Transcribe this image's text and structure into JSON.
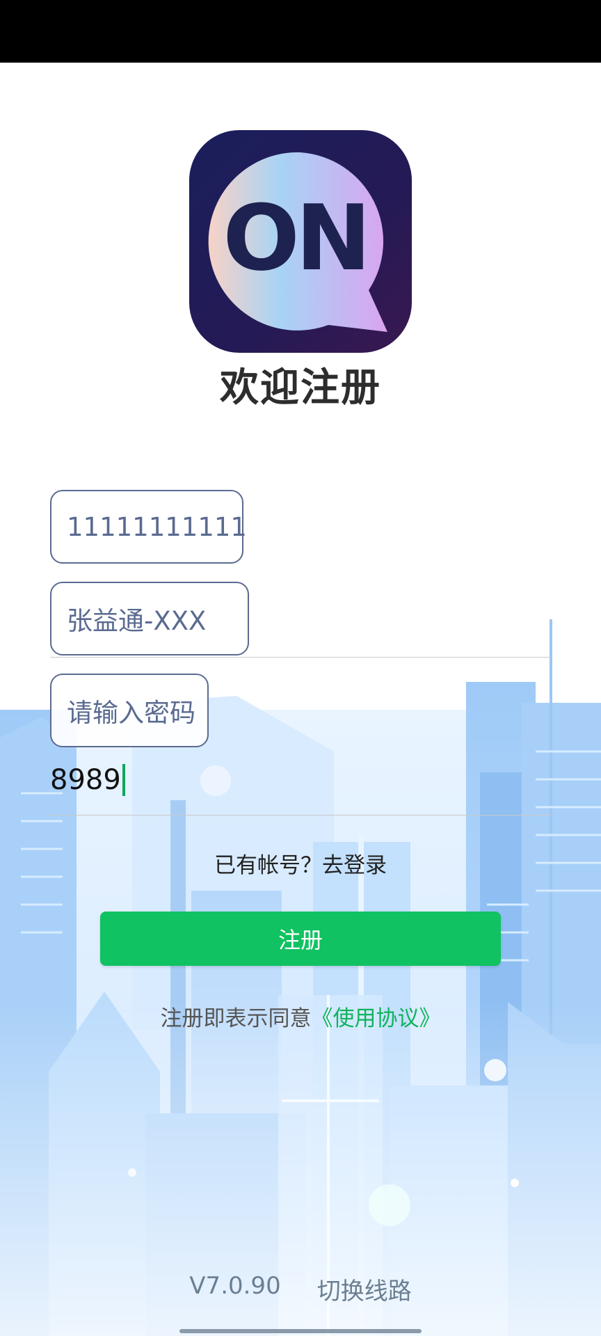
{
  "app": {
    "logo_text": "ON",
    "welcome_title": "欢迎注册"
  },
  "form": {
    "phone_value": "11111111111",
    "name_value": "张益通-XXX",
    "password_placeholder": "请输入密码",
    "typed_value": "8989"
  },
  "links": {
    "login_prompt": "已有帐号？去登录"
  },
  "buttons": {
    "register_label": "注册"
  },
  "agreement": {
    "prefix": "注册即表示同意",
    "link": "《使用协议》"
  },
  "footer": {
    "version": "V7.0.90",
    "switch_line": "切换线路"
  },
  "colors": {
    "accent": "#10c261",
    "field_border": "#5a6a90",
    "link": "#10b35c"
  }
}
